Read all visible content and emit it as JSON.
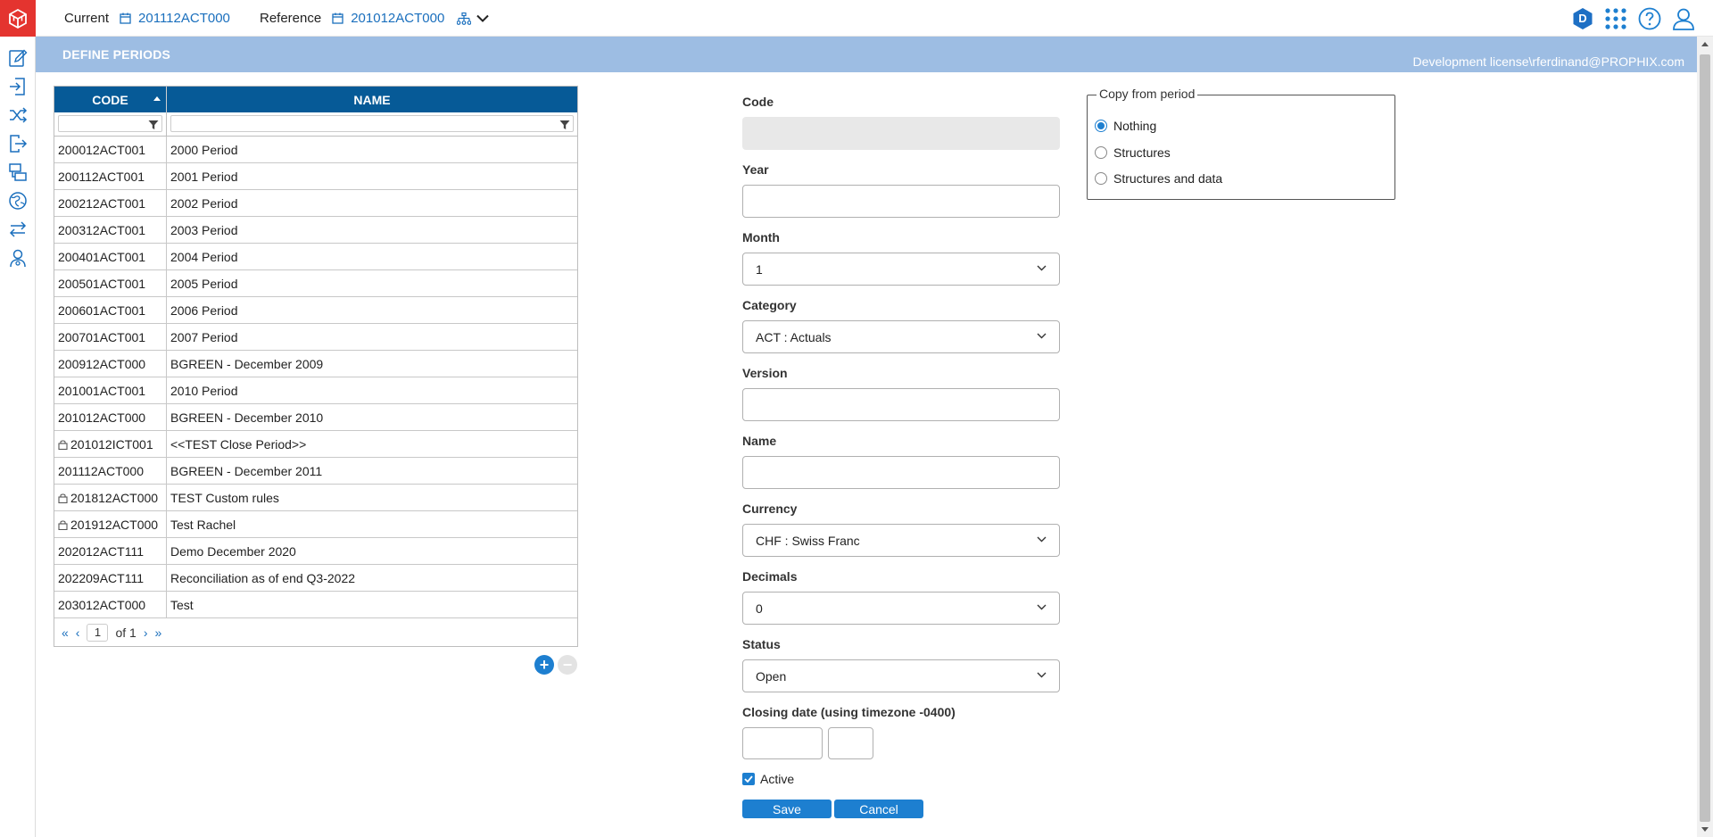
{
  "topbar": {
    "current_label": "Current",
    "current_value": "201112ACT000",
    "reference_label": "Reference",
    "reference_value": "201012ACT000",
    "badge_letter": "D"
  },
  "page": {
    "title": "DEFINE PERIODS",
    "license": "Development license\\rferdinand@PROPHIX.com"
  },
  "grid": {
    "col_code": "CODE",
    "col_name": "NAME",
    "rows": [
      {
        "code": "200012ACT001",
        "name": "2000 Period",
        "locked": false
      },
      {
        "code": "200112ACT001",
        "name": "2001 Period",
        "locked": false
      },
      {
        "code": "200212ACT001",
        "name": "2002 Period",
        "locked": false
      },
      {
        "code": "200312ACT001",
        "name": "2003 Period",
        "locked": false
      },
      {
        "code": "200401ACT001",
        "name": "2004 Period",
        "locked": false
      },
      {
        "code": "200501ACT001",
        "name": "2005 Period",
        "locked": false
      },
      {
        "code": "200601ACT001",
        "name": "2006 Period",
        "locked": false
      },
      {
        "code": "200701ACT001",
        "name": "2007 Period",
        "locked": false
      },
      {
        "code": "200912ACT000",
        "name": "BGREEN - December 2009",
        "locked": false
      },
      {
        "code": "201001ACT001",
        "name": "2010 Period",
        "locked": false
      },
      {
        "code": "201012ACT000",
        "name": "BGREEN - December 2010",
        "locked": false
      },
      {
        "code": "201012ICT001",
        "name": "<<TEST Close Period>>",
        "locked": true
      },
      {
        "code": "201112ACT000",
        "name": "BGREEN - December 2011",
        "locked": false
      },
      {
        "code": "201812ACT000",
        "name": "TEST Custom rules",
        "locked": true
      },
      {
        "code": "201912ACT000",
        "name": "Test Rachel",
        "locked": true
      },
      {
        "code": "202012ACT111",
        "name": "Demo December 2020",
        "locked": false
      },
      {
        "code": "202209ACT111",
        "name": "Reconciliation as of end Q3-2022",
        "locked": false
      },
      {
        "code": "203012ACT000",
        "name": "Test",
        "locked": false
      }
    ],
    "pager": {
      "page": "1",
      "of_text": "of 1"
    }
  },
  "form": {
    "code_label": "Code",
    "code_value": "",
    "year_label": "Year",
    "year_value": "",
    "month_label": "Month",
    "month_value": "1",
    "category_label": "Category",
    "category_value": "ACT : Actuals",
    "version_label": "Version",
    "version_value": "",
    "name_label": "Name",
    "name_value": "",
    "currency_label": "Currency",
    "currency_value": "CHF : Swiss Franc",
    "decimals_label": "Decimals",
    "decimals_value": "0",
    "status_label": "Status",
    "status_value": "Open",
    "closing_label": "Closing date (using timezone -0400)",
    "active_label": "Active",
    "active_checked": true,
    "save_label": "Save",
    "cancel_label": "Cancel"
  },
  "copy_from": {
    "legend": "Copy from period",
    "options": [
      "Nothing",
      "Structures",
      "Structures and data"
    ],
    "selected": "Nothing"
  },
  "colors": {
    "brand_red": "#e4342f",
    "header_blue": "#065a97",
    "band_blue": "#9dbde3",
    "accent": "#1d7fd0",
    "link": "#1a6fbd"
  }
}
